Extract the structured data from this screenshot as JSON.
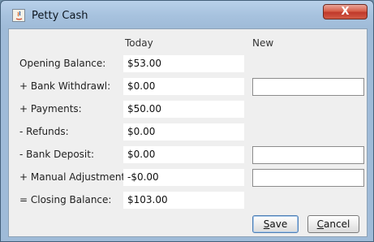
{
  "window": {
    "title": "Petty Cash",
    "close_label": "X"
  },
  "columns": {
    "today": "Today",
    "new": "New"
  },
  "rows": [
    {
      "label": "Opening Balance:",
      "today": "$53.00"
    },
    {
      "label": "+ Bank Withdrawl:",
      "today": "$0.00",
      "new": ""
    },
    {
      "label": "+ Payments:",
      "today": "$50.00"
    },
    {
      "label": "- Refunds:",
      "today": "$0.00"
    },
    {
      "label": "- Bank Deposit:",
      "today": "$0.00",
      "new": ""
    },
    {
      "label": "+ Manual Adjustment:",
      "today": "-$0.00",
      "new": ""
    },
    {
      "label": "= Closing Balance:",
      "today": "$103.00"
    }
  ],
  "buttons": {
    "save_mnemonic": "S",
    "save_rest": "ave",
    "cancel_mnemonic": "C",
    "cancel_rest": "ancel"
  }
}
